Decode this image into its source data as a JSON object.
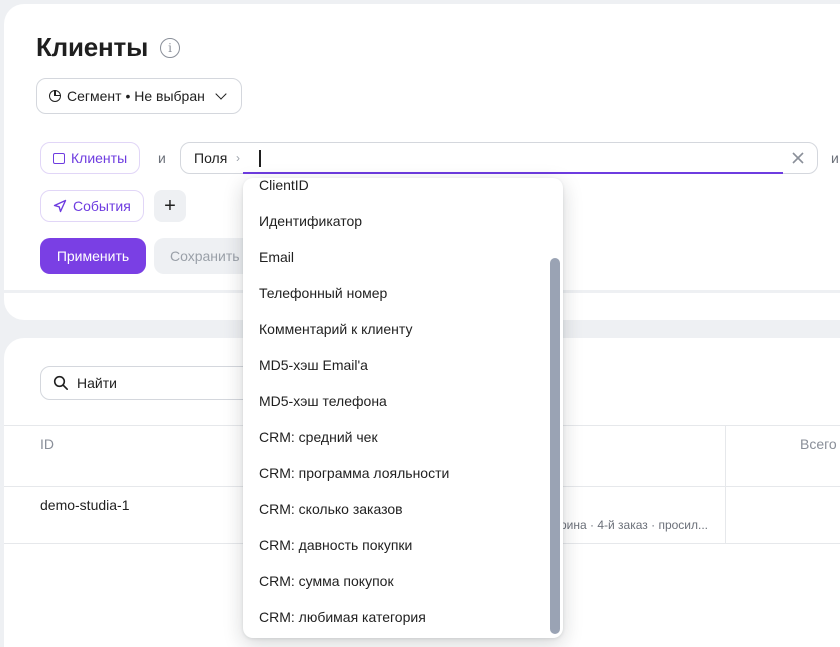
{
  "header": {
    "title": "Клиенты"
  },
  "segment": {
    "label": "Сегмент • Не выбран"
  },
  "filters": {
    "clients_chip": "Клиенты",
    "events_chip": "События",
    "and_label": "и",
    "and_label_right": "и",
    "fields_label": "Поля",
    "fields_chevron": "›",
    "add_label": "+"
  },
  "actions": {
    "apply": "Применить",
    "save": "Сохранить"
  },
  "search": {
    "placeholder": "Найти"
  },
  "table": {
    "columns": {
      "id": "ID",
      "total": "Всего"
    },
    "rows": [
      {
        "id": "demo-studia-1",
        "desc": "рина · 4-й заказ · просил..."
      }
    ]
  },
  "dropdown": {
    "items": [
      "ClientID",
      "Идентификатор",
      "Email",
      "Телефонный номер",
      "Комментарий к клиенту",
      "MD5-хэш Email'a",
      "MD5-хэш телефона",
      "CRM: средний чек",
      "CRM: программа лояльности",
      "CRM: сколько заказов",
      "CRM: давность покупки",
      "CRM: сумма покупок",
      "CRM: любимая категория"
    ]
  },
  "colors": {
    "accent": "#7a3fe4",
    "chip_text": "#6e3ce0",
    "background": "#eef0f3"
  },
  "icons": [
    "info-icon",
    "pie-chart-icon",
    "chevron-down-icon",
    "wallet-icon",
    "send-icon",
    "clear-icon",
    "plus-icon",
    "search-icon"
  ]
}
